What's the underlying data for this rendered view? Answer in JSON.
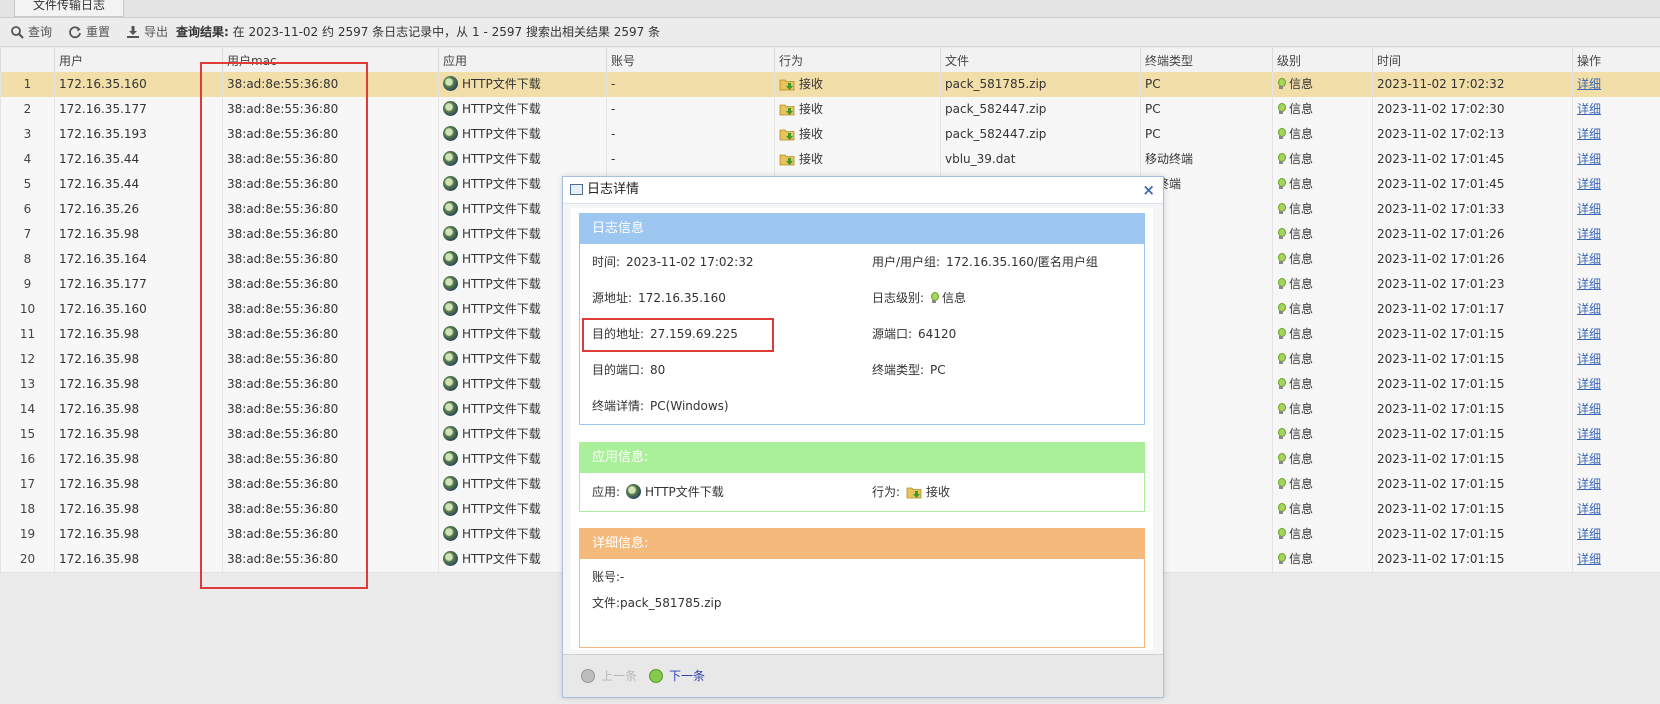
{
  "tab": {
    "label": "文件传输日志"
  },
  "toolbar": {
    "query": "查询",
    "reset": "重置",
    "export": "导出",
    "result_label": "查询结果:",
    "result_text": "在 2023-11-02 约 2597 条日志记录中，从 1 - 2597 搜索出相关结果 2597 条"
  },
  "columns": [
    "用户",
    "用户mac",
    "应用",
    "账号",
    "行为",
    "文件",
    "终端类型",
    "级别",
    "时间",
    "操作"
  ],
  "rows": [
    {
      "idx": "1",
      "user": "172.16.35.160",
      "mac": "38:ad:8e:55:36:80",
      "app": "HTTP文件下载",
      "account": "-",
      "action": "接收",
      "file": "pack_581785.zip",
      "term": "PC",
      "level": "信息",
      "time": "2023-11-02 17:02:32",
      "op": "详细"
    },
    {
      "idx": "2",
      "user": "172.16.35.177",
      "mac": "38:ad:8e:55:36:80",
      "app": "HTTP文件下载",
      "account": "-",
      "action": "接收",
      "file": "pack_582447.zip",
      "term": "PC",
      "level": "信息",
      "time": "2023-11-02 17:02:30",
      "op": "详细"
    },
    {
      "idx": "3",
      "user": "172.16.35.193",
      "mac": "38:ad:8e:55:36:80",
      "app": "HTTP文件下载",
      "account": "-",
      "action": "接收",
      "file": "pack_582447.zip",
      "term": "PC",
      "level": "信息",
      "time": "2023-11-02 17:02:13",
      "op": "详细"
    },
    {
      "idx": "4",
      "user": "172.16.35.44",
      "mac": "38:ad:8e:55:36:80",
      "app": "HTTP文件下载",
      "account": "-",
      "action": "接收",
      "file": "vblu_39.dat",
      "term": "移动终端",
      "level": "信息",
      "time": "2023-11-02 17:01:45",
      "op": "详细"
    },
    {
      "idx": "5",
      "user": "172.16.35.44",
      "mac": "38:ad:8e:55:36:80",
      "app": "HTTP文件下载",
      "account": "",
      "action": "",
      "file": "",
      "term": "动终端",
      "level": "信息",
      "time": "2023-11-02 17:01:45",
      "op": "详细"
    },
    {
      "idx": "6",
      "user": "172.16.35.26",
      "mac": "38:ad:8e:55:36:80",
      "app": "HTTP文件下载",
      "account": "",
      "action": "",
      "file": "",
      "term": "",
      "level": "信息",
      "time": "2023-11-02 17:01:33",
      "op": "详细"
    },
    {
      "idx": "7",
      "user": "172.16.35.98",
      "mac": "38:ad:8e:55:36:80",
      "app": "HTTP文件下载",
      "account": "",
      "action": "",
      "file": "",
      "term": "",
      "level": "信息",
      "time": "2023-11-02 17:01:26",
      "op": "详细"
    },
    {
      "idx": "8",
      "user": "172.16.35.164",
      "mac": "38:ad:8e:55:36:80",
      "app": "HTTP文件下载",
      "account": "",
      "action": "",
      "file": "",
      "term": "",
      "level": "信息",
      "time": "2023-11-02 17:01:26",
      "op": "详细"
    },
    {
      "idx": "9",
      "user": "172.16.35.177",
      "mac": "38:ad:8e:55:36:80",
      "app": "HTTP文件下载",
      "account": "",
      "action": "",
      "file": "",
      "term": "",
      "level": "信息",
      "time": "2023-11-02 17:01:23",
      "op": "详细"
    },
    {
      "idx": "10",
      "user": "172.16.35.160",
      "mac": "38:ad:8e:55:36:80",
      "app": "HTTP文件下载",
      "account": "",
      "action": "",
      "file": "",
      "term": "",
      "level": "信息",
      "time": "2023-11-02 17:01:17",
      "op": "详细"
    },
    {
      "idx": "11",
      "user": "172.16.35.98",
      "mac": "38:ad:8e:55:36:80",
      "app": "HTTP文件下载",
      "account": "",
      "action": "",
      "file": "",
      "term": "",
      "level": "信息",
      "time": "2023-11-02 17:01:15",
      "op": "详细"
    },
    {
      "idx": "12",
      "user": "172.16.35.98",
      "mac": "38:ad:8e:55:36:80",
      "app": "HTTP文件下载",
      "account": "",
      "action": "",
      "file": "",
      "term": "",
      "level": "信息",
      "time": "2023-11-02 17:01:15",
      "op": "详细"
    },
    {
      "idx": "13",
      "user": "172.16.35.98",
      "mac": "38:ad:8e:55:36:80",
      "app": "HTTP文件下载",
      "account": "",
      "action": "",
      "file": "",
      "term": "",
      "level": "信息",
      "time": "2023-11-02 17:01:15",
      "op": "详细"
    },
    {
      "idx": "14",
      "user": "172.16.35.98",
      "mac": "38:ad:8e:55:36:80",
      "app": "HTTP文件下载",
      "account": "",
      "action": "",
      "file": "",
      "term": "",
      "level": "信息",
      "time": "2023-11-02 17:01:15",
      "op": "详细"
    },
    {
      "idx": "15",
      "user": "172.16.35.98",
      "mac": "38:ad:8e:55:36:80",
      "app": "HTTP文件下载",
      "account": "",
      "action": "",
      "file": "",
      "term": "",
      "level": "信息",
      "time": "2023-11-02 17:01:15",
      "op": "详细"
    },
    {
      "idx": "16",
      "user": "172.16.35.98",
      "mac": "38:ad:8e:55:36:80",
      "app": "HTTP文件下载",
      "account": "",
      "action": "",
      "file": "",
      "term": "",
      "level": "信息",
      "time": "2023-11-02 17:01:15",
      "op": "详细"
    },
    {
      "idx": "17",
      "user": "172.16.35.98",
      "mac": "38:ad:8e:55:36:80",
      "app": "HTTP文件下载",
      "account": "",
      "action": "",
      "file": "",
      "term": "",
      "level": "信息",
      "time": "2023-11-02 17:01:15",
      "op": "详细"
    },
    {
      "idx": "18",
      "user": "172.16.35.98",
      "mac": "38:ad:8e:55:36:80",
      "app": "HTTP文件下载",
      "account": "",
      "action": "",
      "file": "",
      "term": "",
      "level": "信息",
      "time": "2023-11-02 17:01:15",
      "op": "详细"
    },
    {
      "idx": "19",
      "user": "172.16.35.98",
      "mac": "38:ad:8e:55:36:80",
      "app": "HTTP文件下载",
      "account": "",
      "action": "",
      "file": "",
      "term": "",
      "level": "信息",
      "time": "2023-11-02 17:01:15",
      "op": "详细"
    },
    {
      "idx": "20",
      "user": "172.16.35.98",
      "mac": "38:ad:8e:55:36:80",
      "app": "HTTP文件下载",
      "account": "",
      "action": "",
      "file": "",
      "term": "",
      "level": "信息",
      "time": "2023-11-02 17:01:15",
      "op": "详细"
    }
  ],
  "dialog": {
    "title": "日志详情",
    "close": "×",
    "log_section": {
      "header": "日志信息",
      "time_label": "时间:",
      "time": "2023-11-02 17:02:32",
      "user_label": "用户/用户组:",
      "user": "172.16.35.160/匿名用户组",
      "src_label": "源地址:",
      "src": "172.16.35.160",
      "level_label": "日志级别:",
      "level": "信息",
      "dst_label": "目的地址:",
      "dst": "27.159.69.225",
      "sport_label": "源端口:",
      "sport": "64120",
      "dport_label": "目的端口:",
      "dport": "80",
      "term_label": "终端类型:",
      "term": "PC",
      "termd_label": "终端详情:",
      "termd": "PC(Windows)"
    },
    "app_section": {
      "header": "应用信息:",
      "app_label": "应用:",
      "app": "HTTP文件下载",
      "action_label": "行为:",
      "action": "接收"
    },
    "detail_section": {
      "header": "详细信息:",
      "account_label": "账号:",
      "account": "-",
      "file_label": "文件:",
      "file": "pack_581785.zip"
    },
    "prev": "上一条",
    "next": "下一条"
  },
  "colors": {
    "selected_row": "#f2dea9",
    "log_header": "#9dc6f0",
    "app_header": "#aaf09b",
    "detail_header": "#f5b97c",
    "highlight": "#e03a3a"
  }
}
